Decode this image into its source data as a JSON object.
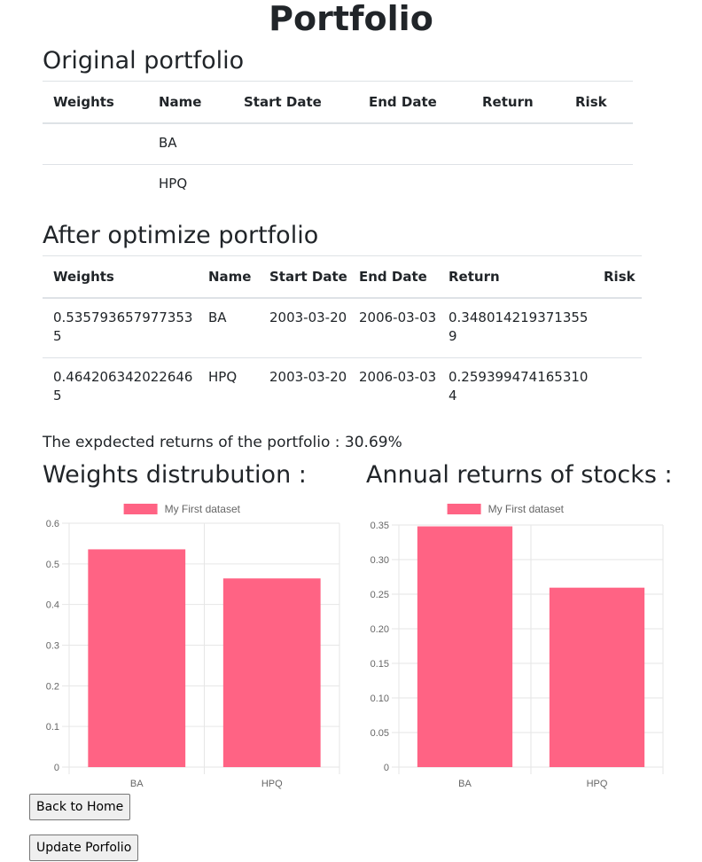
{
  "page": {
    "title": "Portfolio"
  },
  "original": {
    "title": "Original portfolio",
    "headers": [
      "Weights",
      "Name",
      "Start Date",
      "End Date",
      "Return",
      "Risk"
    ],
    "rows": [
      [
        "",
        "BA",
        "",
        "",
        "",
        ""
      ],
      [
        "",
        "HPQ",
        "",
        "",
        "",
        ""
      ]
    ]
  },
  "optimized": {
    "title": "After optimize portfolio",
    "headers": [
      "Weights",
      "Name",
      "Start Date",
      "End Date",
      "Return",
      "Risk"
    ],
    "rows": [
      [
        "0.5357936579773535",
        "BA",
        "2003-03-20",
        "2006-03-03",
        "0.3480142193713559",
        ""
      ],
      [
        "0.4642063420226465",
        "HPQ",
        "2003-03-20",
        "2006-03-03",
        "0.2593994741653104",
        ""
      ]
    ]
  },
  "expected": {
    "label": "The expdected returns of the portfolio : ",
    "value": "30.69%"
  },
  "charts": {
    "weights_title": "Weights distrubution :",
    "returns_title": "Annual returns of stocks :"
  },
  "buttons": {
    "back_home": "Back to Home",
    "update": "Update Porfolio"
  },
  "colors": {
    "bar_fill": "#ff6384",
    "grid": "#e6e6e6",
    "tick_text": "#666666"
  },
  "chart_data": [
    {
      "type": "bar",
      "title": "",
      "categories": [
        "BA",
        "HPQ"
      ],
      "series": [
        {
          "name": "My First dataset",
          "values": [
            0.5357936579773535,
            0.4642063420226465
          ]
        }
      ],
      "ylim": [
        0,
        0.6
      ],
      "yticks": [
        "0",
        "0.1",
        "0.2",
        "0.3",
        "0.4",
        "0.5",
        "0.6"
      ],
      "legend": "top-center",
      "grid": true
    },
    {
      "type": "bar",
      "title": "",
      "categories": [
        "BA",
        "HPQ"
      ],
      "series": [
        {
          "name": "My First dataset",
          "values": [
            0.3480142193713559,
            0.2593994741653104
          ]
        }
      ],
      "ylim": [
        0,
        0.35
      ],
      "yticks": [
        "0",
        "0.05",
        "0.10",
        "0.15",
        "0.20",
        "0.25",
        "0.30",
        "0.35"
      ],
      "legend": "top-center",
      "grid": true
    }
  ]
}
